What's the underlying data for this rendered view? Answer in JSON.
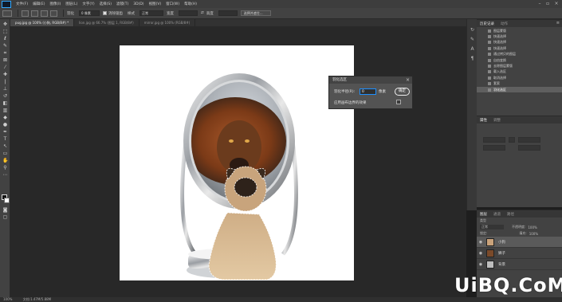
{
  "menubar": {
    "items": [
      "文件(F)",
      "编辑(E)",
      "图像(I)",
      "图层(L)",
      "文字(Y)",
      "选择(S)",
      "滤镜(T)",
      "3D(D)",
      "视图(V)",
      "窗口(W)",
      "帮助(H)"
    ]
  },
  "options_bar": {
    "feather_label": "羽化",
    "feather_value": "0 像素",
    "antialias_label": "消除锯齿",
    "style_label": "样式",
    "style_value": "正常",
    "width_label": "宽度",
    "height_label": "高度",
    "refine_button": "选择并遮住..."
  },
  "tabs": [
    {
      "label": "pug.jpg @ 100% (小狗, RGB/8#) *",
      "active": true
    },
    {
      "label": "lion.jpg @ 66.7% (图层 1, RGB/8#)",
      "active": false
    },
    {
      "label": "mirror.jpg @ 100% (RGB/8#)",
      "active": false
    }
  ],
  "dialog": {
    "title": "羽化选区",
    "radius_label": "羽化半径(R):",
    "radius_value": "0",
    "unit_label": "像素",
    "ok_label": "确定",
    "checkbox_label": "应用画布边界的效果"
  },
  "history_panel": {
    "tabs": [
      "历史记录",
      "动作"
    ],
    "items": [
      {
        "label": "图层蒙版",
        "active": false
      },
      {
        "label": "快速选择",
        "active": false
      },
      {
        "label": "快速选择",
        "active": false
      },
      {
        "label": "快速选择",
        "active": false
      },
      {
        "label": "通过拷贝的图层",
        "active": false
      },
      {
        "label": "自由变换",
        "active": false
      },
      {
        "label": "去除图层蒙版",
        "active": false
      },
      {
        "label": "载入选区",
        "active": false
      },
      {
        "label": "取消选择",
        "active": false
      },
      {
        "label": "套索",
        "active": false
      },
      {
        "label": "羽化选区",
        "active": true
      }
    ]
  },
  "properties_panel": {
    "tabs": [
      "属性",
      "调整"
    ]
  },
  "layers_panel": {
    "tabs": [
      "图层",
      "通道",
      "路径"
    ],
    "kind_label": "类型",
    "mode_value": "正常",
    "opacity_label": "不透明度:",
    "opacity_value": "100%",
    "lock_label": "锁定:",
    "fill_label": "填充:",
    "fill_value": "100%",
    "layers": [
      {
        "name": "小狗",
        "thumb_color": "#c9a27a",
        "visible": true,
        "selected": true
      },
      {
        "name": "狮子",
        "thumb_color": "#7a4a2a",
        "visible": true,
        "selected": false
      },
      {
        "name": "背景",
        "thumb_color": "#bdbdbd",
        "visible": true,
        "selected": false
      }
    ]
  },
  "status": {
    "zoom": "100%",
    "doc_info": "文档:1.47M/5.88M"
  },
  "watermark": "UiBQ.CoM",
  "colors": {
    "accent": "#31a8ff",
    "panel_bg": "#424242",
    "canvas_bg": "#282828"
  }
}
